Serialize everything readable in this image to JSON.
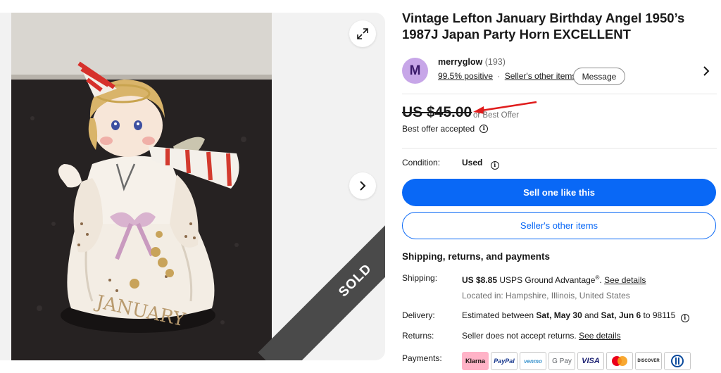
{
  "listing": {
    "title": "Vintage Lefton January Birthday Angel 1950’s 1987J Japan Party Horn EXCELLENT"
  },
  "gallery": {
    "sold_label": "SOLD",
    "figurine_text": "JANUARY",
    "expand_icon": "expand-icon",
    "next_icon": "chevron-right-icon"
  },
  "seller": {
    "avatar_letter": "M",
    "name": "merryglow",
    "feedback_count": "(193)",
    "positive": "99.5% positive",
    "separator": "·",
    "other_items": "Seller's other items",
    "message_button": "Message",
    "avatar_color": "#c7a6e8"
  },
  "price": {
    "amount": "US $45.00",
    "or_best_offer": "or Best Offer",
    "offer_status": "Best offer accepted"
  },
  "condition": {
    "label": "Condition:",
    "value": "Used"
  },
  "actions": {
    "sell_one": "Sell one like this",
    "sellers_other_items": "Seller's other items",
    "primary_color": "#0968f6"
  },
  "shipping_section": {
    "title": "Shipping, returns, and payments",
    "shipping_label": "Shipping:",
    "shipping_cost": "US $8.85",
    "shipping_service": "USPS Ground Advantage",
    "shipping_mark": "®",
    "shipping_see_details": "See details",
    "located_in": "Located in: Hampshire, Illinois, United States",
    "delivery_label": "Delivery:",
    "delivery_prefix": "Estimated between",
    "delivery_start": "Sat, May 30",
    "delivery_and": "and",
    "delivery_end": "Sat, Jun 6",
    "delivery_zip": "to 98115",
    "returns_label": "Returns:",
    "returns_text": "Seller does not accept returns.",
    "returns_see_details": "See details",
    "payments_label": "Payments:",
    "payment_methods": [
      "Klarna",
      "PayPal",
      "venmo",
      "G Pay",
      "VISA",
      "mastercard",
      "DISCOVER",
      "diners-club"
    ]
  },
  "annotation": {
    "arrow_color": "#e01c1c"
  }
}
